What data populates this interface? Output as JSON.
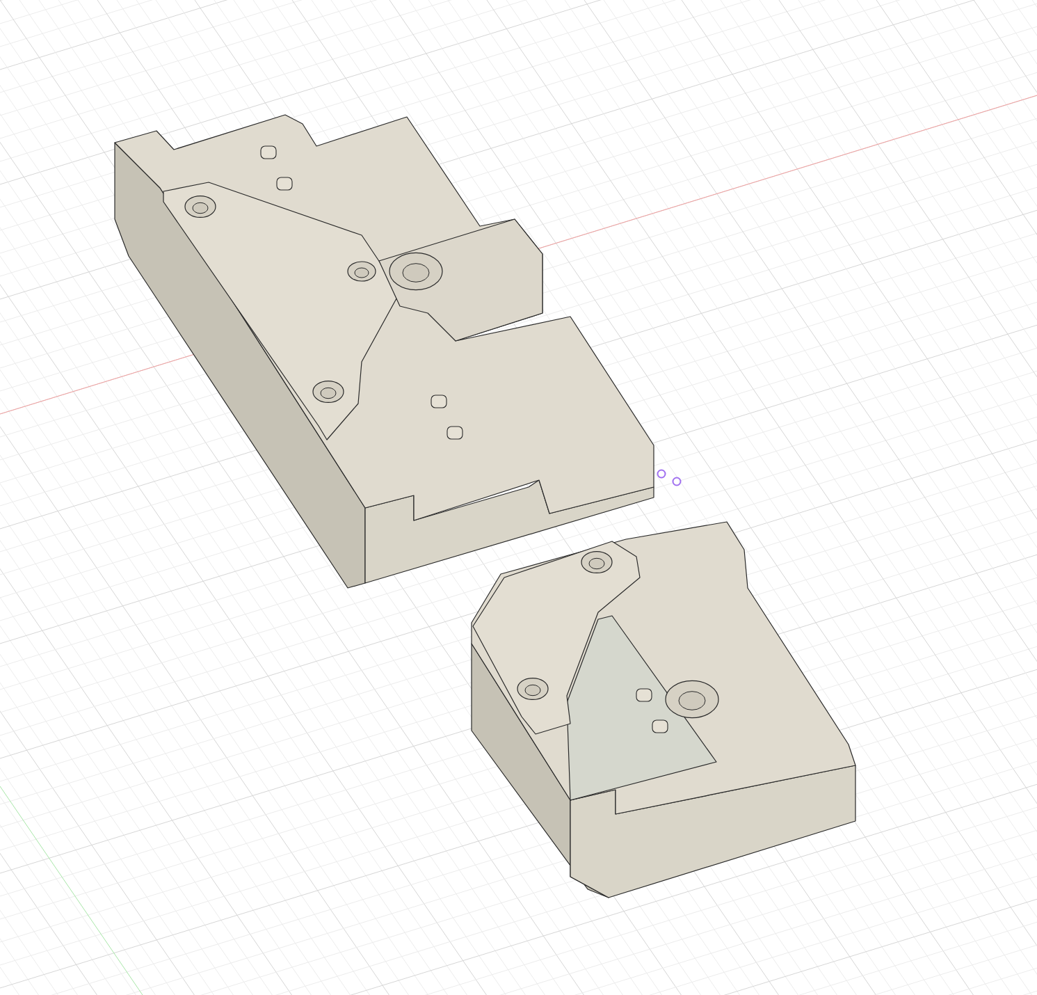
{
  "viewport": {
    "show_grid": true,
    "parts": [
      {
        "kind": "long-block"
      },
      {
        "kind": "short-block"
      }
    ],
    "markers": [
      {
        "kind": "point"
      },
      {
        "kind": "point"
      }
    ]
  }
}
